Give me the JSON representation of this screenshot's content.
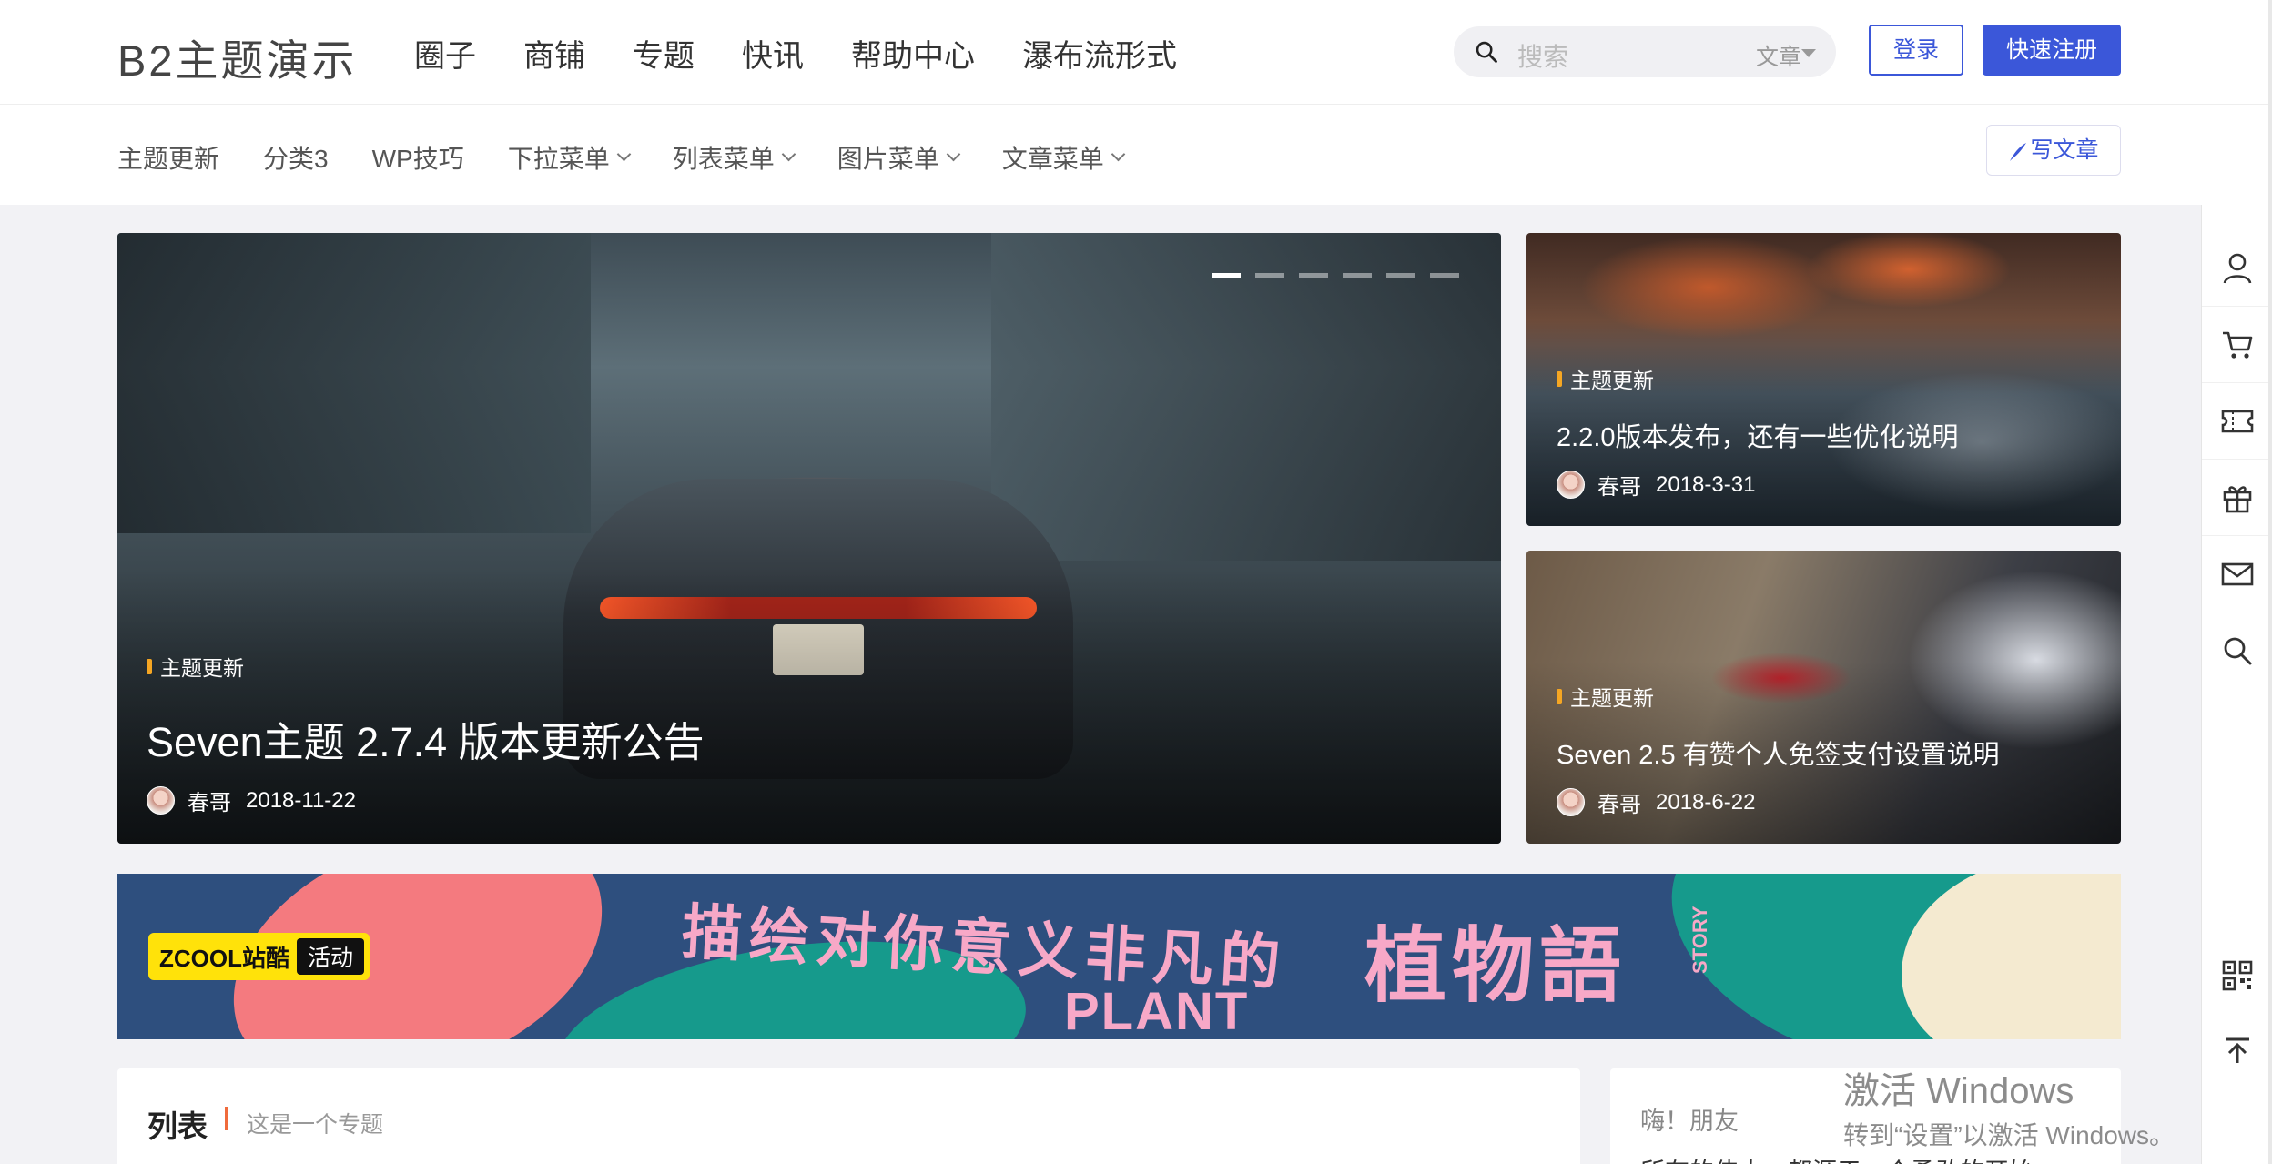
{
  "header": {
    "logo": "B2主题演示",
    "nav": [
      "圈子",
      "商铺",
      "专题",
      "快讯",
      "帮助中心",
      "瀑布流形式"
    ],
    "search": {
      "placeholder": "搜索",
      "category": "文章"
    },
    "login_label": "登录",
    "register_label": "快速注册",
    "accent_color": "#3b57d9"
  },
  "subnav": {
    "items": [
      {
        "label": "主题更新",
        "dropdown": false
      },
      {
        "label": "分类3",
        "dropdown": false
      },
      {
        "label": "WP技巧",
        "dropdown": false
      },
      {
        "label": "下拉菜单",
        "dropdown": true
      },
      {
        "label": "列表菜单",
        "dropdown": true
      },
      {
        "label": "图片菜单",
        "dropdown": true
      },
      {
        "label": "文章菜单",
        "dropdown": true
      }
    ],
    "write_label": "写文章"
  },
  "slider": {
    "slide_count": 6,
    "active_index": 0,
    "tag": "主题更新",
    "title": "Seven主题 2.7.4 版本更新公告",
    "author": "春哥",
    "date": "2018-11-22"
  },
  "cards": [
    {
      "tag": "主题更新",
      "title": "2.2.0版本发布，还有一些优化说明",
      "author": "春哥",
      "date": "2018-3-31"
    },
    {
      "tag": "主题更新",
      "title": "Seven 2.5 有赞个人免签支付设置说明",
      "author": "春哥",
      "date": "2018-6-22"
    }
  ],
  "banner": {
    "brand": "ZCOOL站酷",
    "badge": "活动",
    "headline": "描绘对你意义非凡的",
    "plant": "PLANT",
    "title": "植物語",
    "story": "STORY"
  },
  "right_sidebar": {
    "icons": [
      "user-icon",
      "cart-icon",
      "ticket-icon",
      "gift-icon",
      "mail-icon",
      "search-icon"
    ],
    "bottom_icons": [
      "qrcode-icon",
      "back-to-top-icon"
    ]
  },
  "list_section": {
    "title": "列表",
    "subtitle": "这是一个专题"
  },
  "greeting": {
    "title": "嗨！朋友",
    "text": "所有的伟大，都源于一个勇敢的开始"
  },
  "watermark": {
    "line1": "激活 Windows",
    "line2": "转到“设置”以激活 Windows。"
  }
}
